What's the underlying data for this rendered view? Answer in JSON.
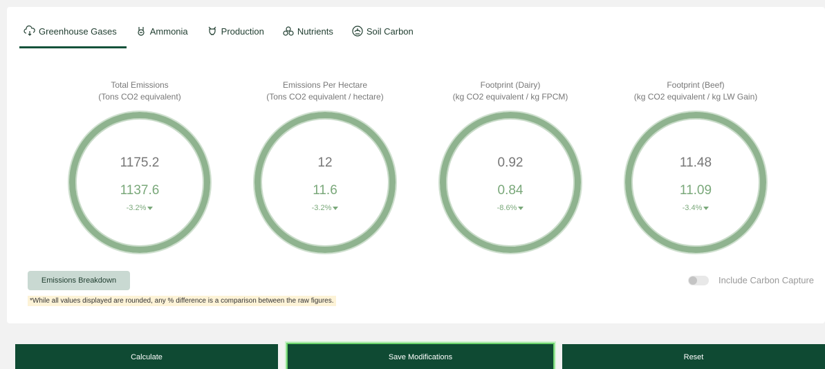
{
  "tabs": [
    {
      "label": "Greenhouse Gases",
      "icon": "cloud-icon",
      "active": true
    },
    {
      "label": "Ammonia",
      "icon": "ammonia-icon",
      "active": false
    },
    {
      "label": "Production",
      "icon": "production-icon",
      "active": false
    },
    {
      "label": "Nutrients",
      "icon": "nutrients-icon",
      "active": false
    },
    {
      "label": "Soil Carbon",
      "icon": "soil-carbon-icon",
      "active": false
    }
  ],
  "metrics": [
    {
      "title": "Total Emissions",
      "subtitle": "(Tons CO2 equivalent)",
      "baseline": "1175.2",
      "modified": "1137.6",
      "change": "-3.2%"
    },
    {
      "title": "Emissions Per Hectare",
      "subtitle": "(Tons CO2 equivalent / hectare)",
      "baseline": "12",
      "modified": "11.6",
      "change": "-3.2%"
    },
    {
      "title": "Footprint (Dairy)",
      "subtitle": "(kg CO2 equivalent / kg FPCM)",
      "baseline": "0.92",
      "modified": "0.84",
      "change": "-8.6%"
    },
    {
      "title": "Footprint (Beef)",
      "subtitle": "(kg CO2 equivalent / kg LW Gain)",
      "baseline": "11.48",
      "modified": "11.09",
      "change": "-3.4%"
    }
  ],
  "breakdown_label": "Emissions Breakdown",
  "carbon_capture": {
    "label": "Include Carbon Capture",
    "checked": false
  },
  "note": "*While all values displayed are rounded, any % difference is a comparison between the raw figures.",
  "actions": {
    "calculate": "Calculate",
    "save": "Save Modifications",
    "reset": "Reset"
  },
  "colors": {
    "primary": "#0f4a33",
    "ring": "#8fb38f",
    "modified_value": "#7aa87a",
    "note_bg": "#fdf3d7",
    "save_glow": "#6dd36d"
  }
}
